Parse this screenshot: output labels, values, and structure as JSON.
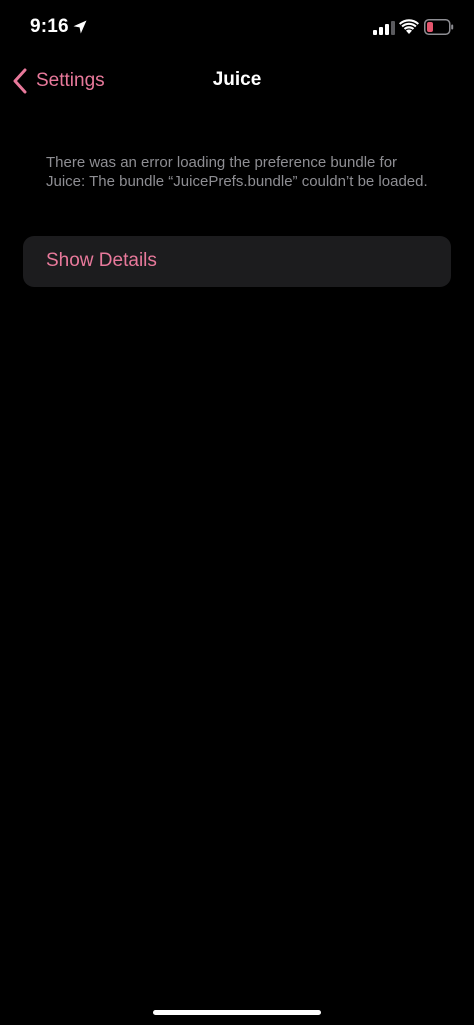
{
  "status_bar": {
    "time": "9:16",
    "icons": [
      "location-arrow-icon",
      "cellular-signal-icon",
      "wifi-icon",
      "battery-low-icon"
    ],
    "battery_color": "#e5566e"
  },
  "nav": {
    "back_label": "Settings",
    "title": "Juice"
  },
  "content": {
    "error_message": "There was an error loading the preference bundle for Juice: The bundle “JuicePrefs.bundle” couldn’t be loaded.",
    "details_button_label": "Show Details"
  },
  "colors": {
    "accent": "#e8799b",
    "background": "#000000",
    "cell_background": "#1c1c1e",
    "secondary_text": "#8e8e93"
  }
}
